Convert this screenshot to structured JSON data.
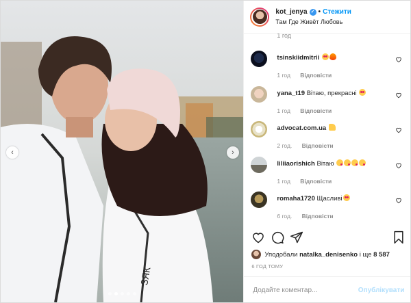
{
  "header": {
    "username": "kot_jenya",
    "separator": "•",
    "follow_label": "Стежити",
    "location": "Там Где Живёт Любовь"
  },
  "comments": {
    "partial_time": "1 год",
    "items": [
      {
        "username": "tsinskiidmitrii",
        "text": "",
        "emojis": [
          "heart-eyes",
          "fire"
        ],
        "time": "1 год",
        "reply": "Відповісти"
      },
      {
        "username": "yana_t19",
        "text": "Вітаю, прекрасні",
        "emojis": [
          "heart-eyes"
        ],
        "time": "1 год",
        "reply": "Відповісти"
      },
      {
        "username": "advocat.com.ua",
        "text": "",
        "emojis": [
          "thumbs-up"
        ],
        "time": "2 год.",
        "reply": "Відповісти"
      },
      {
        "username": "liliiaorishich",
        "text": "Вітаю",
        "emojis": [
          "kiss",
          "kiss",
          "kiss",
          "kiss"
        ],
        "time": "1 год",
        "reply": "Відповісти"
      },
      {
        "username": "romaha1720",
        "text": "Щасливі",
        "emojis": [
          "heart-eyes"
        ],
        "time": "6 год.",
        "reply": "Відповісти"
      }
    ]
  },
  "likes": {
    "prefix": "Уподобали",
    "user": "natalka_denisenko",
    "middle": "і ще",
    "count": "8 587"
  },
  "timestamp": "6 ГОД ТОМУ",
  "add_comment": {
    "placeholder": "Додайте коментар...",
    "publish_label": "Опублікувати"
  },
  "colors": {
    "accent": "#0095f6",
    "publish_disabled": "#b2dffc",
    "muted": "#8e8e8e"
  },
  "carousel": {
    "dot_count": 5,
    "active_dot": 1
  }
}
